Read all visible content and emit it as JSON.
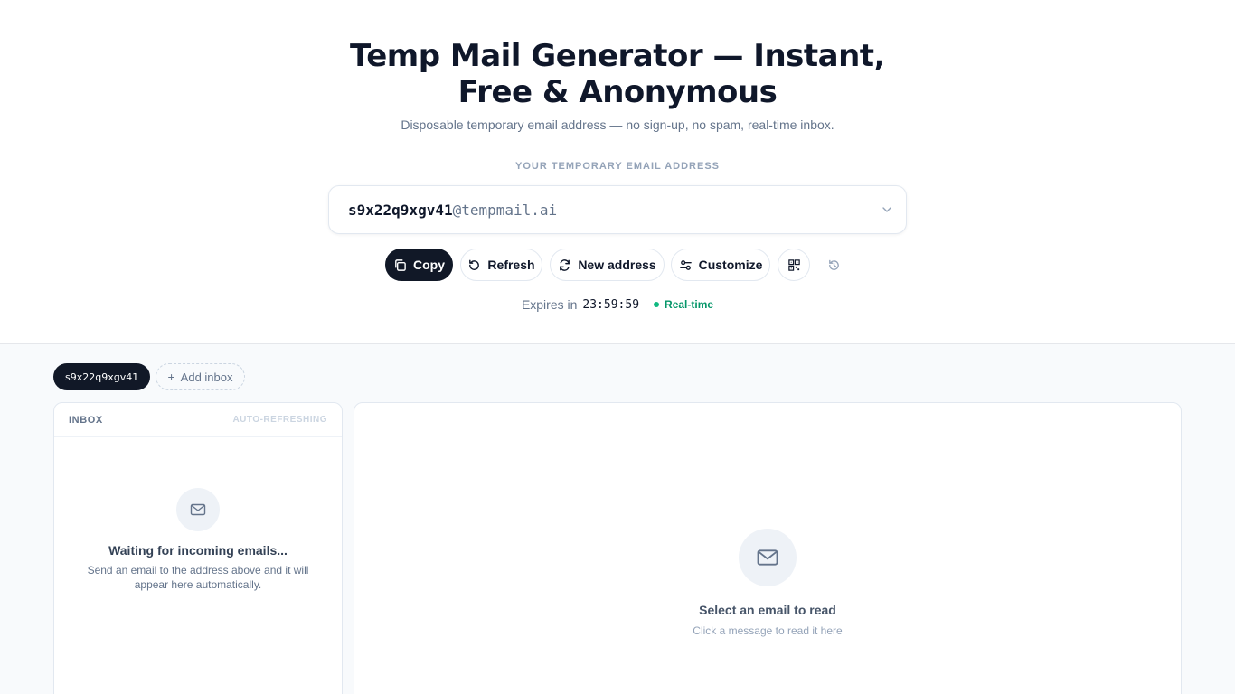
{
  "hero": {
    "title": "Temp Mail Generator — Instant, Free & Anonymous",
    "subtitle": "Disposable temporary email address — no sign-up, no spam, real-time inbox.",
    "address_label": "YOUR TEMPORARY EMAIL ADDRESS"
  },
  "address": {
    "username": "s9x22q9xgv41",
    "domain": "@tempmail.ai"
  },
  "actions": {
    "copy": "Copy",
    "refresh": "Refresh",
    "new_address": "New address",
    "customize": "Customize"
  },
  "status": {
    "expires_label": "Expires in",
    "timer": "23:59:59",
    "realtime": "Real-time"
  },
  "inboxes": {
    "active": "s9x22q9xgv41",
    "add_label": "Add inbox"
  },
  "inbox": {
    "title": "INBOX",
    "auto_refresh": "AUTO-REFRESHING",
    "empty_title": "Waiting for incoming emails...",
    "empty_text": "Send an email to the address above and it will appear here automatically."
  },
  "reader": {
    "empty_title": "Select an email to read",
    "empty_text": "Click a message to read it here"
  },
  "colors": {
    "primary_dark": "#111827",
    "accent_green": "#10b981",
    "muted": "#64748b",
    "panel_bg": "#f8fafc"
  },
  "icons": [
    "copy-icon",
    "refresh-icon",
    "new-address-icon",
    "customize-icon",
    "qr-code-icon",
    "history-icon",
    "mail-icon",
    "chevron-down-icon",
    "plus-icon"
  ]
}
